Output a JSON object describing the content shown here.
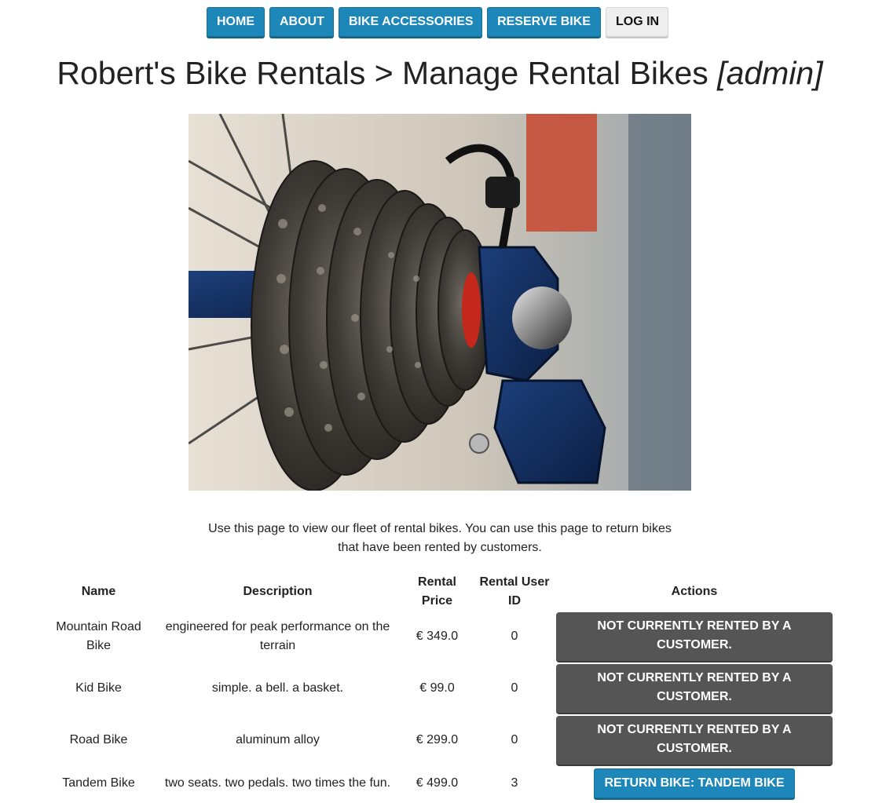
{
  "nav": {
    "items": [
      {
        "label": "HOME",
        "style": "primary"
      },
      {
        "label": "ABOUT",
        "style": "primary"
      },
      {
        "label": "BIKE ACCESSORIES",
        "style": "primary"
      },
      {
        "label": "RESERVE BIKE",
        "style": "primary"
      },
      {
        "label": "LOG IN",
        "style": "plain"
      }
    ]
  },
  "header": {
    "title": "Robert's Bike Rentals > Manage Rental Bikes",
    "role_tag": "[admin]"
  },
  "hero": {
    "subject": "close-up of bicycle rear cassette and derailleur"
  },
  "intro": {
    "text": "Use this page to view our fleet of rental bikes. You can use this page to return bikes that have been rented by customers."
  },
  "table": {
    "headers": {
      "name": "Name",
      "description": "Description",
      "price": "Rental Price",
      "user_id": "Rental User ID",
      "actions": "Actions"
    },
    "rows": [
      {
        "name": "Mountain Road Bike",
        "description": "engineered for peak performance on the terrain",
        "price": "€ 349.0",
        "user_id": "0",
        "action": "NOT CURRENTLY RENTED BY A CUSTOMER.",
        "action_type": "status"
      },
      {
        "name": "Kid Bike",
        "description": "simple. a bell. a basket.",
        "price": "€ 99.0",
        "user_id": "0",
        "action": "NOT CURRENTLY RENTED BY A CUSTOMER.",
        "action_type": "status"
      },
      {
        "name": "Road Bike",
        "description": "aluminum alloy",
        "price": "€ 299.0",
        "user_id": "0",
        "action": "NOT CURRENTLY RENTED BY A CUSTOMER.",
        "action_type": "status"
      },
      {
        "name": "Tandem Bike",
        "description": "two seats. two pedals. two times the fun.",
        "price": "€ 499.0",
        "user_id": "3",
        "action": "RETURN BIKE: TANDEM BIKE",
        "action_type": "button"
      }
    ]
  },
  "colors": {
    "primary_button": "#1c87b8",
    "status_block": "#555555",
    "plain_button": "#eeeeee",
    "text": "#222222"
  }
}
